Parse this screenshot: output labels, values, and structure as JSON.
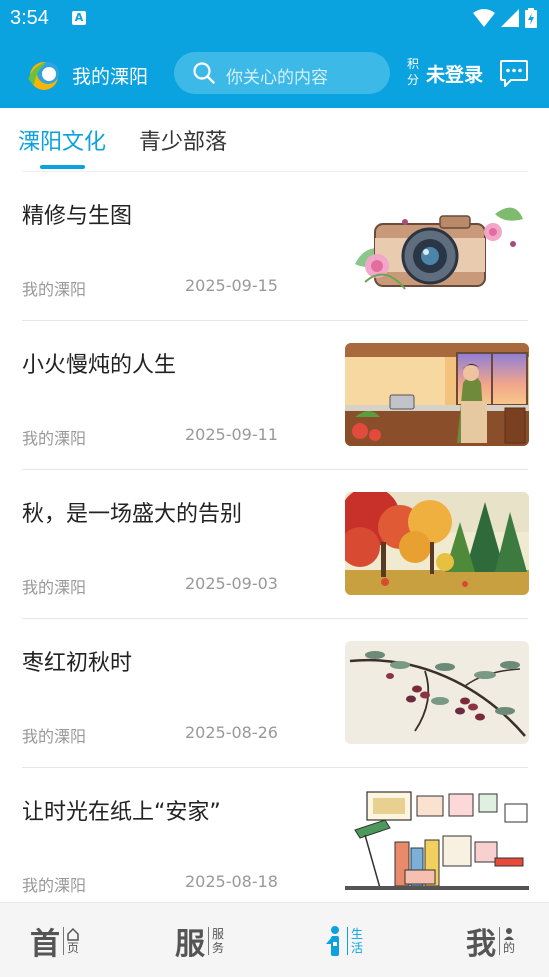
{
  "status_bar": {
    "time": "3:54",
    "keyboard_icon_letter": "A"
  },
  "header": {
    "app_name": "我的溧阳",
    "search_placeholder": "你关心的内容",
    "points_label": "积分",
    "login_label": "未登录",
    "accent_color": "#0aa3df"
  },
  "tabs": [
    {
      "label": "溧阳文化",
      "active": true
    },
    {
      "label": "青少部落",
      "active": false
    }
  ],
  "articles": [
    {
      "title": "精修与生图",
      "source": "我的溧阳",
      "date": "2025-09-15",
      "thumb": "camera-with-flowers-illustration"
    },
    {
      "title": "小火慢炖的人生",
      "source": "我的溧阳",
      "date": "2025-09-11",
      "thumb": "woman-cooking-kitchen-illustration"
    },
    {
      "title": "秋，是一场盛大的告别",
      "source": "我的溧阳",
      "date": "2025-09-03",
      "thumb": "autumn-forest-painting"
    },
    {
      "title": "枣红初秋时",
      "source": "我的溧阳",
      "date": "2025-08-26",
      "thumb": "jujube-branch-ink-painting"
    },
    {
      "title": "让时光在纸上“安家”",
      "source": "我的溧阳",
      "date": "2025-08-18",
      "thumb": "desk-sketch-illustration"
    }
  ],
  "bottom_nav": [
    {
      "big": "首",
      "small1": "首",
      "small2": "页",
      "icon": "home-icon",
      "active": false
    },
    {
      "big": "服",
      "small1": "服",
      "small2": "务",
      "icon": "service-icon",
      "active": false
    },
    {
      "big": "",
      "small1": "生",
      "small2": "活",
      "icon": "life-icon",
      "active": true
    },
    {
      "big": "我",
      "small1": "我",
      "small2": "的",
      "icon": "user-icon",
      "active": false
    }
  ]
}
